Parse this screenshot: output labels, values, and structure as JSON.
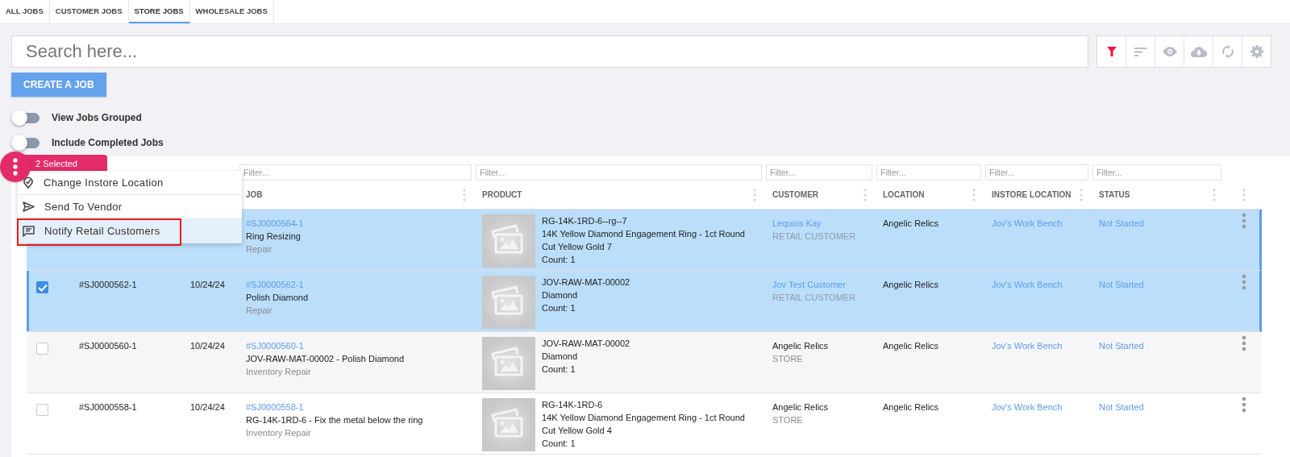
{
  "tabs": [
    {
      "label": "ALL JOBS",
      "selected": false
    },
    {
      "label": "CUSTOMER JOBS",
      "selected": false
    },
    {
      "label": "STORE JOBS",
      "selected": true
    },
    {
      "label": "WHOLESALE JOBS",
      "selected": false
    }
  ],
  "search": {
    "placeholder": "Search here..."
  },
  "toolbar": [
    {
      "kind": "filter",
      "active": true
    },
    {
      "kind": "sort",
      "active": false
    },
    {
      "kind": "view",
      "active": false
    },
    {
      "kind": "download",
      "active": false
    },
    {
      "kind": "refresh",
      "active": false
    },
    {
      "kind": "settings",
      "active": false
    }
  ],
  "create_button": "CREATE A JOB",
  "toggles": [
    {
      "label": "View Jobs Grouped",
      "on": false
    },
    {
      "label": "Include Completed Jobs",
      "on": false
    }
  ],
  "selection": {
    "count_label": "2 Selected"
  },
  "menu": [
    {
      "kind": "location",
      "label": "Change Instore Location",
      "selected": false
    },
    {
      "kind": "send",
      "label": "Send To Vendor",
      "selected": false
    },
    {
      "kind": "notify",
      "label": "Notify Retail Customers",
      "selected": true
    }
  ],
  "filters": [
    {
      "placeholder": "Filter..."
    },
    {
      "placeholder": "Filter..."
    },
    {
      "placeholder": "Filter..."
    },
    {
      "placeholder": "Filter..."
    },
    {
      "placeholder": "Filter..."
    },
    {
      "placeholder": "Filter..."
    }
  ],
  "columns": [
    "JOB",
    "PRODUCT",
    "CUSTOMER",
    "LOCATION",
    "INSTORE LOCATION",
    "STATUS"
  ],
  "rows": [
    {
      "selected": true,
      "job_id": "#SJ0000564-1",
      "job_title": "Ring Resizing",
      "job_type": "Repair",
      "product": [
        "RG-14K-1RD-6--rg--7",
        "14K Yellow Diamond Engagement Ring - 1ct Round Cut Yellow Gold 7",
        "Count: 1"
      ],
      "customer": {
        "name": "Lequiris Kay",
        "type": "RETAIL CUSTOMER",
        "kind": "retail"
      },
      "location": "Angelic Relics",
      "instore_location": "Jov's Work Bench",
      "status": "Not Started"
    },
    {
      "selected": true,
      "checked": true,
      "number": "#SJ0000562-1",
      "date": "10/24/24",
      "job_id": "#SJ0000562-1",
      "job_title": "Polish Diamond",
      "job_type": "Repair",
      "product": [
        "JOV-RAW-MAT-00002",
        "Diamond",
        "Count: 1"
      ],
      "customer": {
        "name": "Jov Test Customer",
        "type": "RETAIL CUSTOMER",
        "kind": "retail"
      },
      "location": "Angelic Relics",
      "instore_location": "Jov's Work Bench",
      "status": "Not Started"
    },
    {
      "selected": false,
      "checked": false,
      "number": "#SJ0000560-1",
      "date": "10/24/24",
      "job_id": "#SJ0000560-1",
      "job_title": "JOV-RAW-MAT-00002 - Polish Diamond",
      "job_type": "Inventory Repair",
      "product": [
        "JOV-RAW-MAT-00002",
        "Diamond",
        "Count: 1"
      ],
      "customer": {
        "name": "Angelic Relics",
        "type": "STORE",
        "kind": "store"
      },
      "location": "Angelic Relics",
      "instore_location": "Jov's Work Bench",
      "status": "Not Started"
    },
    {
      "selected": false,
      "checked": false,
      "number": "#SJ0000558-1",
      "date": "10/24/24",
      "job_id": "#SJ0000558-1",
      "job_title": "RG-14K-1RD-6 - Fix the metal below the ring",
      "job_type": "Inventory Repair",
      "product": [
        "RG-14K-1RD-6",
        "14K Yellow Diamond Engagement Ring - 1ct Round Cut Yellow Gold 4",
        "Count: 1"
      ],
      "customer": {
        "name": "Angelic Relics",
        "type": "STORE",
        "kind": "store"
      },
      "location": "Angelic Relics",
      "instore_location": "Jov's Work Bench",
      "status": "Not Started"
    }
  ]
}
